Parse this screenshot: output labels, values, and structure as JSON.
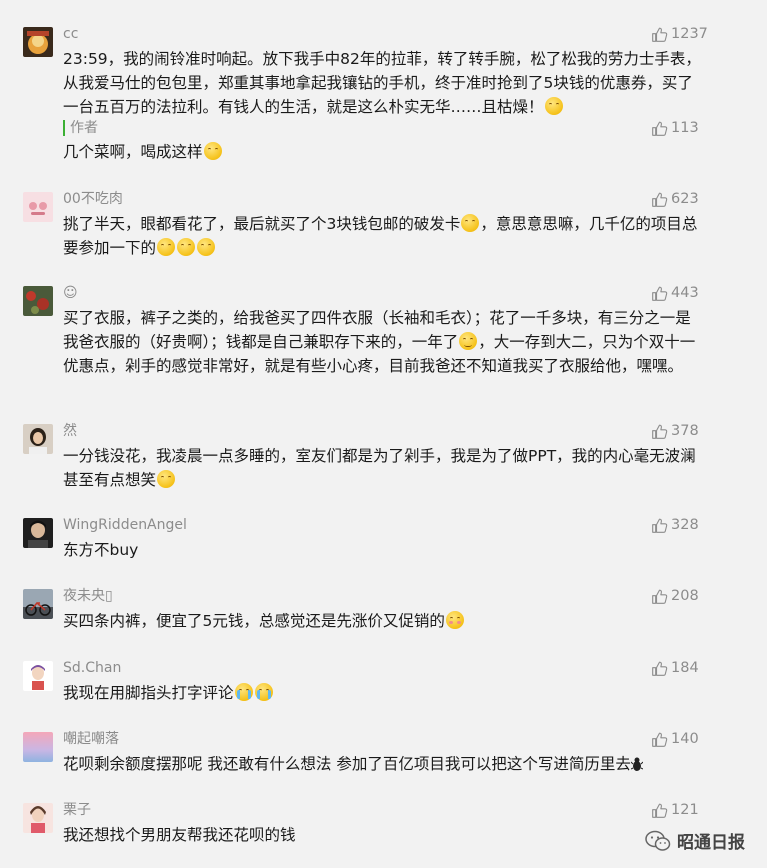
{
  "comments": [
    {
      "name": "cc",
      "likes": "1237",
      "text": "23:59，我的闹铃准时响起。放下我手中82年的拉菲，转了转手腕，松了松我的劳力士手表，从我爱马仕的包包里，郑重其事地拿起我镶钻的手机，终于准时抢到了5块钱的优惠券，买了一台五百万的法拉利。有钱人的生活，就是这么朴实无华……且枯燥！",
      "reply": {
        "label": "作者",
        "likes": "113",
        "text": "几个菜啊，喝成这样"
      }
    },
    {
      "name": "00不吃肉",
      "likes": "623",
      "text_a": "挑了半天，眼都看花了，最后就买了个3块钱包邮的破发卡",
      "text_b": "，意思意思嘛，几千亿的项目总要参加一下的"
    },
    {
      "name": "☺",
      "likes": "443",
      "text_a": "买了衣服，裤子之类的，给我爸买了四件衣服（长袖和毛衣）；花了一千多块，有三分之一是我爸衣服的（好贵啊）；钱都是自己兼职存下来的，一年了",
      "text_b": "，大一存到大二，只为个双十一优惠点，剁手的感觉非常好，就是有些小心疼，目前我爸还不知道我买了衣服给他，嘿嘿。"
    },
    {
      "name": "然",
      "likes": "378",
      "text": "一分钱没花，我凌晨一点多睡的，室友们都是为了剁手，我是为了做PPT，我的内心毫无波澜甚至有点想笑"
    },
    {
      "name": "WingRiddenAngel",
      "likes": "328",
      "text": "东方不buy"
    },
    {
      "name": "夜未央▯",
      "likes": "208",
      "text": "买四条内裤，便宜了5元钱，总感觉还是先涨价又促销的"
    },
    {
      "name": "Sd.Chan",
      "likes": "184",
      "text": "我现在用脚指头打字评论"
    },
    {
      "name": "嘲起嘲落",
      "likes": "140",
      "text_a": "花呗剩余额度摆那呢 我还敢有什么想法",
      "text_b": " 参加了百亿项目我可以把这个写进简历里去"
    },
    {
      "name": "栗子",
      "likes": "121",
      "text": "我还想找个男朋友帮我还花呗的钱"
    }
  ],
  "watermark": {
    "text": "昭通日报"
  },
  "colors": {
    "accent_green": "#3cb034",
    "meta_gray": "#8c8c8c"
  }
}
